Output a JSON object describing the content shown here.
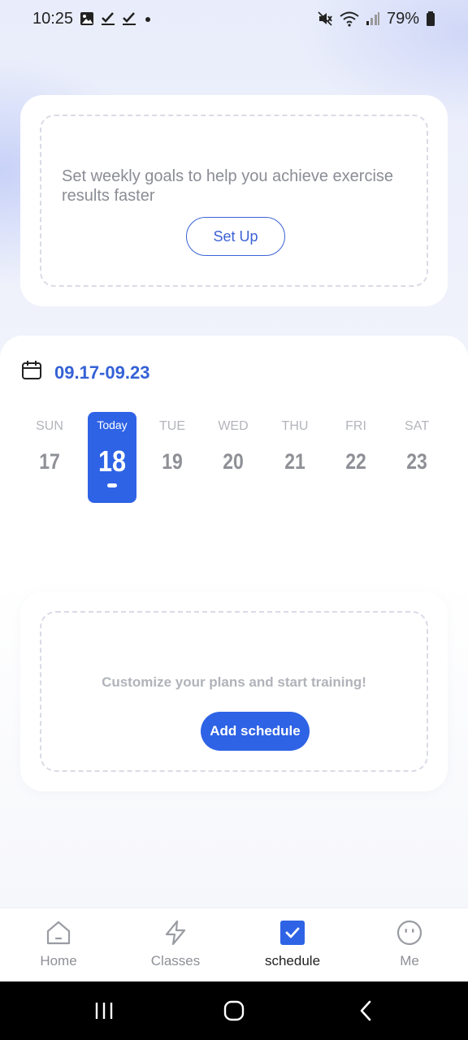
{
  "status_bar": {
    "time": "10:25",
    "battery": "79%",
    "left_icons": [
      "image-icon",
      "check-icon",
      "check-icon",
      "dot-icon"
    ],
    "right_icons": [
      "mute-icon",
      "wifi-icon",
      "signal-icon",
      "battery-icon"
    ]
  },
  "goal_card": {
    "text": "Set weekly goals to help you achieve exercise results faster",
    "button_label": "Set Up"
  },
  "week": {
    "range": "09.17-09.23",
    "days": [
      {
        "name": "SUN",
        "num": "17"
      },
      {
        "name": "Today",
        "num": "18",
        "active": true
      },
      {
        "name": "TUE",
        "num": "19"
      },
      {
        "name": "WED",
        "num": "20"
      },
      {
        "name": "THU",
        "num": "21"
      },
      {
        "name": "FRI",
        "num": "22"
      },
      {
        "name": "SAT",
        "num": "23"
      }
    ]
  },
  "schedule_card": {
    "text": "Customize your plans and start training!",
    "button_label": "Add schedule"
  },
  "bottom_nav": {
    "items": [
      {
        "label": "Home",
        "icon": "home-icon"
      },
      {
        "label": "Classes",
        "icon": "lightning-icon"
      },
      {
        "label": "schedule",
        "icon": "checkbox-icon",
        "active": true
      },
      {
        "label": "Me",
        "icon": "smiley-icon"
      }
    ]
  },
  "colors": {
    "accent": "#2e63e6",
    "link": "#3561d6"
  }
}
